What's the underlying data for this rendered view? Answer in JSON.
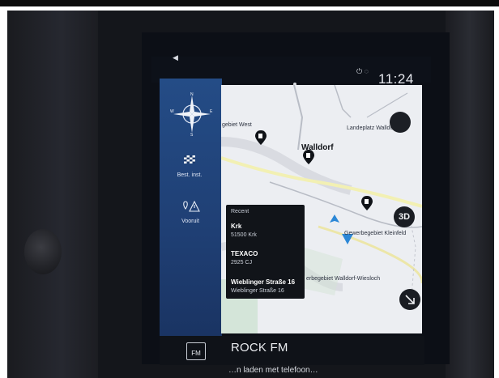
{
  "status_bar": {
    "time": "11:24"
  },
  "sidebar": {
    "compass_letters": {
      "n": "N",
      "e": "E",
      "s": "S",
      "w": "W"
    },
    "items": [
      {
        "label": "Best. inst.",
        "icon": "checkered-flag-icon"
      },
      {
        "label": "Vooruit",
        "icon": "road-warning-icon"
      }
    ]
  },
  "map": {
    "labels": {
      "gebiet_west": "gebiet West",
      "landeplatz": "Landeplatz Walldorf",
      "walldorf": "Walldorf",
      "gewerbegebiet_kleinfeld": "Gewerbegebiet Kleinfeld",
      "gewerbegebiet_wiesloch": "erbegebiet Walldorf-Wiesloch"
    },
    "buttons": {
      "three_d": "3D"
    },
    "colors": {
      "position_marker": "#2b87d6"
    }
  },
  "recent_panel": {
    "header": "Recent",
    "items": [
      {
        "title": "Krk",
        "subtitle": "51500 Krk"
      },
      {
        "title": "TEXACO",
        "subtitle": "2925 CJ"
      },
      {
        "title": "Wieblinger Straße 16",
        "subtitle": "Wieblinger Straße 16"
      }
    ]
  },
  "media": {
    "source_icon_label": "FM",
    "station": "ROCK FM",
    "phone_notice": "…n laden met telefoon…"
  }
}
